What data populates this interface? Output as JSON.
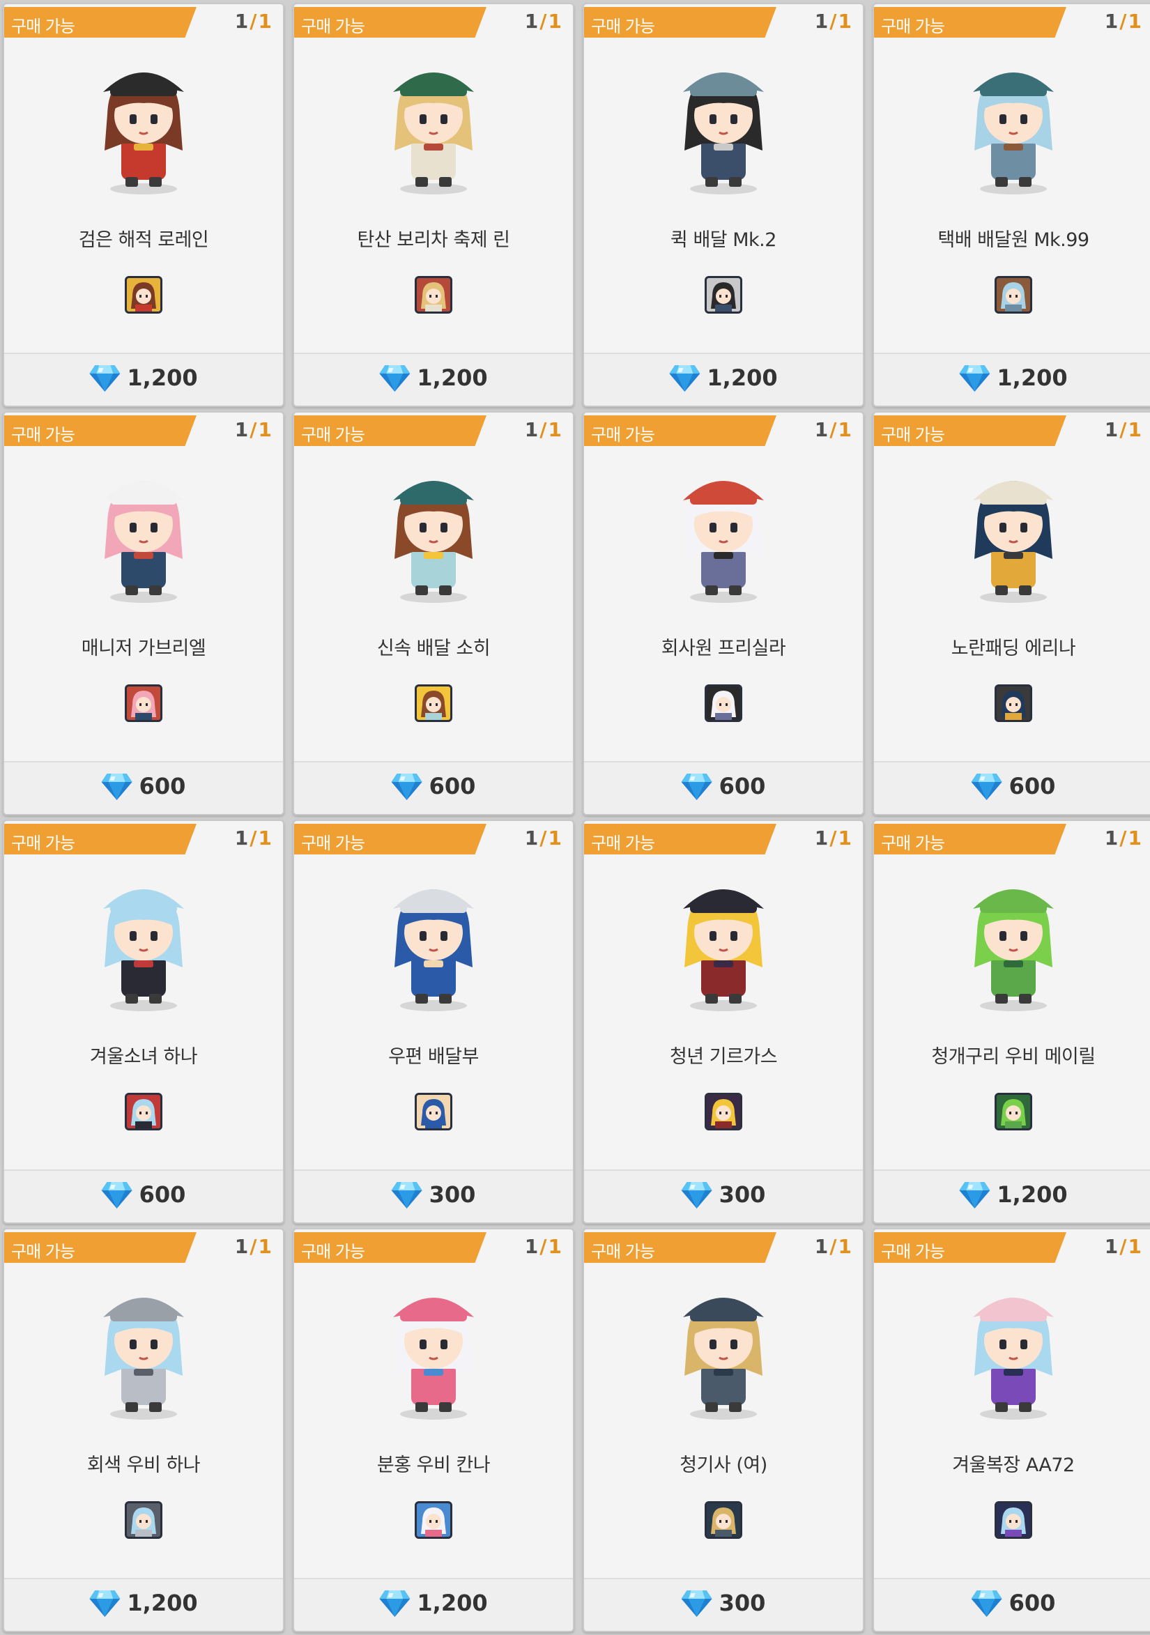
{
  "shop": {
    "items": [
      {
        "badge": "구매 가능",
        "stock_current": "1",
        "stock_sep": "/",
        "stock_max": "1",
        "name": "검은 해적 로레인",
        "price": "1,200",
        "portrait_icon": "pirate-character-portrait",
        "hair": "#7a3a26",
        "hat": "#2b2b2b",
        "outfit": "#c53a2c",
        "accent": "#e8b33a"
      },
      {
        "badge": "구매 가능",
        "stock_current": "1",
        "stock_sep": "/",
        "stock_max": "1",
        "name": "탄산 보리차 축제 린",
        "price": "1,200",
        "portrait_icon": "festival-character-portrait",
        "hair": "#e5c27a",
        "hat": "#2f6b4a",
        "outfit": "#e9e1cf",
        "accent": "#b54a3a"
      },
      {
        "badge": "구매 가능",
        "stock_current": "1",
        "stock_sep": "/",
        "stock_max": "1",
        "name": "퀵 배달 Mk.2",
        "price": "1,200",
        "portrait_icon": "courier-helmet-character-portrait",
        "hair": "#2a2a2a",
        "hat": "#6c8c9a",
        "outfit": "#3b4f6a",
        "accent": "#c9c9c9"
      },
      {
        "badge": "구매 가능",
        "stock_current": "1",
        "stock_sep": "/",
        "stock_max": "1",
        "name": "택배 배달원 Mk.99",
        "price": "1,200",
        "portrait_icon": "delivery-character-portrait",
        "hair": "#a8d3e6",
        "hat": "#3a6f77",
        "outfit": "#6e8fa3",
        "accent": "#8a5a3a"
      },
      {
        "badge": "구매 가능",
        "stock_current": "1",
        "stock_sep": "/",
        "stock_max": "1",
        "name": "매니저 가브리엘",
        "price": "600",
        "portrait_icon": "manager-character-portrait",
        "hair": "#f2a7b8",
        "hat": "#f2f2f2",
        "outfit": "#2e4a6a",
        "accent": "#c24a3a"
      },
      {
        "badge": "구매 가능",
        "stock_current": "1",
        "stock_sep": "/",
        "stock_max": "1",
        "name": "신속 배달 소히",
        "price": "600",
        "portrait_icon": "fast-delivery-character-portrait",
        "hair": "#8a4a2a",
        "hat": "#2f6a6a",
        "outfit": "#a8d3d9",
        "accent": "#f2c53a"
      },
      {
        "badge": "구매 가능",
        "stock_current": "1",
        "stock_sep": "/",
        "stock_max": "1",
        "name": "회사원 프리실라",
        "price": "600",
        "portrait_icon": "office-worker-character-portrait",
        "hair": "#f4f4f8",
        "hat": "#d04a3a",
        "outfit": "#6a6f9a",
        "accent": "#2a2a2a"
      },
      {
        "badge": "구매 가능",
        "stock_current": "1",
        "stock_sep": "/",
        "stock_max": "1",
        "name": "노란패딩 에리나",
        "price": "600",
        "portrait_icon": "yellow-padding-character-portrait",
        "hair": "#1f3a5a",
        "hat": "#e9e1cf",
        "outfit": "#e2a83a",
        "accent": "#3a3a3a"
      },
      {
        "badge": "구매 가능",
        "stock_current": "1",
        "stock_sep": "/",
        "stock_max": "1",
        "name": "겨울소녀 하나",
        "price": "600",
        "portrait_icon": "winter-girl-character-portrait",
        "hair": "#a9d8ef",
        "hat": "#a9d8ef",
        "outfit": "#2a2a35",
        "accent": "#c03a3a"
      },
      {
        "badge": "구매 가능",
        "stock_current": "1",
        "stock_sep": "/",
        "stock_max": "1",
        "name": "우편 배달부",
        "price": "300",
        "portrait_icon": "mail-carrier-character-portrait",
        "hair": "#2a5aa8",
        "hat": "#d9dde2",
        "outfit": "#2a5aa8",
        "accent": "#f2d7b0"
      },
      {
        "badge": "구매 가능",
        "stock_current": "1",
        "stock_sep": "/",
        "stock_max": "1",
        "name": "청년 기르가스",
        "price": "300",
        "portrait_icon": "dragon-youth-character-portrait",
        "hair": "#f2c53a",
        "hat": "#2a2a35",
        "outfit": "#8a2a2a",
        "accent": "#3a2a45"
      },
      {
        "badge": "구매 가능",
        "stock_current": "1",
        "stock_sep": "/",
        "stock_max": "1",
        "name": "청개구리 우비 메이릴",
        "price": "1,200",
        "portrait_icon": "frog-raincoat-character-portrait",
        "hair": "#7ad04a",
        "hat": "#6ab84a",
        "outfit": "#5aa84a",
        "accent": "#2f6a3a"
      },
      {
        "badge": "구매 가능",
        "stock_current": "1",
        "stock_sep": "/",
        "stock_max": "1",
        "name": "회색 우비 하나",
        "price": "1,200",
        "portrait_icon": "gray-raincoat-character-portrait",
        "hair": "#a9d8ef",
        "hat": "#9aa0a8",
        "outfit": "#b9bec6",
        "accent": "#5a5f6a"
      },
      {
        "badge": "구매 가능",
        "stock_current": "1",
        "stock_sep": "/",
        "stock_max": "1",
        "name": "분홍 우비 칸나",
        "price": "1,200",
        "portrait_icon": "pink-raincoat-character-portrait",
        "hair": "#f4f4f8",
        "hat": "#e86a8a",
        "outfit": "#e86a8a",
        "accent": "#4a8ad0"
      },
      {
        "badge": "구매 가능",
        "stock_current": "1",
        "stock_sep": "/",
        "stock_max": "1",
        "name": "청기사 (여)",
        "price": "300",
        "portrait_icon": "blue-knight-character-portrait",
        "hair": "#d9b56a",
        "hat": "#3a4a5a",
        "outfit": "#4a5a6a",
        "accent": "#2a3a4a"
      },
      {
        "badge": "구매 가능",
        "stock_current": "1",
        "stock_sep": "/",
        "stock_max": "1",
        "name": "겨울복장 AA72",
        "price": "600",
        "portrait_icon": "winter-outfit-character-portrait",
        "hair": "#a9d8ef",
        "hat": "#f2c4cf",
        "outfit": "#7a4ab8",
        "accent": "#2a2f55"
      }
    ],
    "currency_icon": "diamond-gem-icon",
    "colors": {
      "badge": "#f0a032",
      "stock_accent": "#e0901c",
      "gem_light": "#9fe3ff",
      "gem_dark": "#1f7fd1"
    }
  }
}
